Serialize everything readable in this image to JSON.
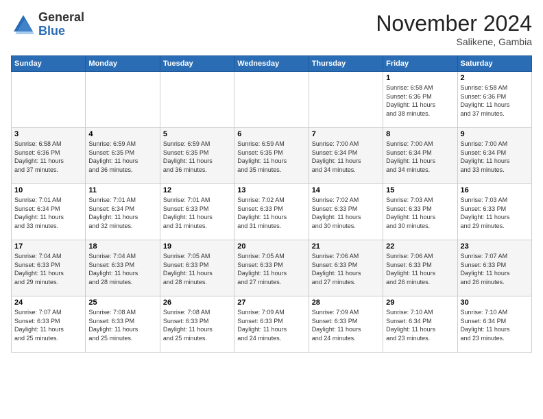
{
  "logo": {
    "general": "General",
    "blue": "Blue"
  },
  "header": {
    "month": "November 2024",
    "location": "Salikene, Gambia"
  },
  "weekdays": [
    "Sunday",
    "Monday",
    "Tuesday",
    "Wednesday",
    "Thursday",
    "Friday",
    "Saturday"
  ],
  "weeks": [
    [
      {
        "day": "",
        "info": ""
      },
      {
        "day": "",
        "info": ""
      },
      {
        "day": "",
        "info": ""
      },
      {
        "day": "",
        "info": ""
      },
      {
        "day": "",
        "info": ""
      },
      {
        "day": "1",
        "info": "Sunrise: 6:58 AM\nSunset: 6:36 PM\nDaylight: 11 hours\nand 38 minutes."
      },
      {
        "day": "2",
        "info": "Sunrise: 6:58 AM\nSunset: 6:36 PM\nDaylight: 11 hours\nand 37 minutes."
      }
    ],
    [
      {
        "day": "3",
        "info": "Sunrise: 6:58 AM\nSunset: 6:36 PM\nDaylight: 11 hours\nand 37 minutes."
      },
      {
        "day": "4",
        "info": "Sunrise: 6:59 AM\nSunset: 6:35 PM\nDaylight: 11 hours\nand 36 minutes."
      },
      {
        "day": "5",
        "info": "Sunrise: 6:59 AM\nSunset: 6:35 PM\nDaylight: 11 hours\nand 36 minutes."
      },
      {
        "day": "6",
        "info": "Sunrise: 6:59 AM\nSunset: 6:35 PM\nDaylight: 11 hours\nand 35 minutes."
      },
      {
        "day": "7",
        "info": "Sunrise: 7:00 AM\nSunset: 6:34 PM\nDaylight: 11 hours\nand 34 minutes."
      },
      {
        "day": "8",
        "info": "Sunrise: 7:00 AM\nSunset: 6:34 PM\nDaylight: 11 hours\nand 34 minutes."
      },
      {
        "day": "9",
        "info": "Sunrise: 7:00 AM\nSunset: 6:34 PM\nDaylight: 11 hours\nand 33 minutes."
      }
    ],
    [
      {
        "day": "10",
        "info": "Sunrise: 7:01 AM\nSunset: 6:34 PM\nDaylight: 11 hours\nand 33 minutes."
      },
      {
        "day": "11",
        "info": "Sunrise: 7:01 AM\nSunset: 6:34 PM\nDaylight: 11 hours\nand 32 minutes."
      },
      {
        "day": "12",
        "info": "Sunrise: 7:01 AM\nSunset: 6:33 PM\nDaylight: 11 hours\nand 31 minutes."
      },
      {
        "day": "13",
        "info": "Sunrise: 7:02 AM\nSunset: 6:33 PM\nDaylight: 11 hours\nand 31 minutes."
      },
      {
        "day": "14",
        "info": "Sunrise: 7:02 AM\nSunset: 6:33 PM\nDaylight: 11 hours\nand 30 minutes."
      },
      {
        "day": "15",
        "info": "Sunrise: 7:03 AM\nSunset: 6:33 PM\nDaylight: 11 hours\nand 30 minutes."
      },
      {
        "day": "16",
        "info": "Sunrise: 7:03 AM\nSunset: 6:33 PM\nDaylight: 11 hours\nand 29 minutes."
      }
    ],
    [
      {
        "day": "17",
        "info": "Sunrise: 7:04 AM\nSunset: 6:33 PM\nDaylight: 11 hours\nand 29 minutes."
      },
      {
        "day": "18",
        "info": "Sunrise: 7:04 AM\nSunset: 6:33 PM\nDaylight: 11 hours\nand 28 minutes."
      },
      {
        "day": "19",
        "info": "Sunrise: 7:05 AM\nSunset: 6:33 PM\nDaylight: 11 hours\nand 28 minutes."
      },
      {
        "day": "20",
        "info": "Sunrise: 7:05 AM\nSunset: 6:33 PM\nDaylight: 11 hours\nand 27 minutes."
      },
      {
        "day": "21",
        "info": "Sunrise: 7:06 AM\nSunset: 6:33 PM\nDaylight: 11 hours\nand 27 minutes."
      },
      {
        "day": "22",
        "info": "Sunrise: 7:06 AM\nSunset: 6:33 PM\nDaylight: 11 hours\nand 26 minutes."
      },
      {
        "day": "23",
        "info": "Sunrise: 7:07 AM\nSunset: 6:33 PM\nDaylight: 11 hours\nand 26 minutes."
      }
    ],
    [
      {
        "day": "24",
        "info": "Sunrise: 7:07 AM\nSunset: 6:33 PM\nDaylight: 11 hours\nand 25 minutes."
      },
      {
        "day": "25",
        "info": "Sunrise: 7:08 AM\nSunset: 6:33 PM\nDaylight: 11 hours\nand 25 minutes."
      },
      {
        "day": "26",
        "info": "Sunrise: 7:08 AM\nSunset: 6:33 PM\nDaylight: 11 hours\nand 25 minutes."
      },
      {
        "day": "27",
        "info": "Sunrise: 7:09 AM\nSunset: 6:33 PM\nDaylight: 11 hours\nand 24 minutes."
      },
      {
        "day": "28",
        "info": "Sunrise: 7:09 AM\nSunset: 6:33 PM\nDaylight: 11 hours\nand 24 minutes."
      },
      {
        "day": "29",
        "info": "Sunrise: 7:10 AM\nSunset: 6:34 PM\nDaylight: 11 hours\nand 23 minutes."
      },
      {
        "day": "30",
        "info": "Sunrise: 7:10 AM\nSunset: 6:34 PM\nDaylight: 11 hours\nand 23 minutes."
      }
    ]
  ]
}
